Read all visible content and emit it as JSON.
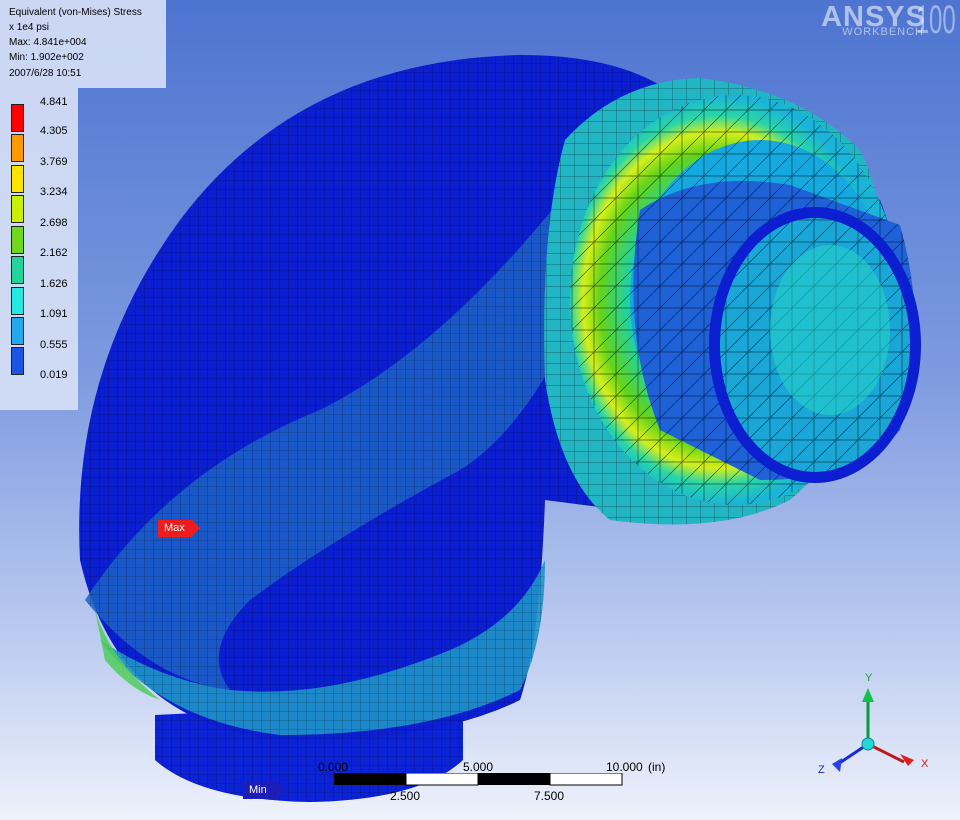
{
  "result": {
    "title": "Equivalent (von-Mises) Stress",
    "units": "x 1e4 psi",
    "max": "Max: 4.841e+004",
    "min": "Min: 1.902e+002",
    "timestamp": "2007/6/28 10:51"
  },
  "legend": {
    "entries": [
      {
        "label": "4.841",
        "color": "#ff0000"
      },
      {
        "label": "4.305",
        "color": "#ff9900"
      },
      {
        "label": "3.769",
        "color": "#ffe300"
      },
      {
        "label": "3.234",
        "color": "#c8f000"
      },
      {
        "label": "2.698",
        "color": "#6fd81c"
      },
      {
        "label": "2.162",
        "color": "#22d39a"
      },
      {
        "label": "1.626",
        "color": "#25e8e0"
      },
      {
        "label": "1.091",
        "color": "#25a7ee"
      },
      {
        "label": "0.555",
        "color": "#1a55e6"
      },
      {
        "label": "0.019",
        "color": "#0d0dc8"
      }
    ]
  },
  "brand": {
    "name": "ANSYS",
    "version": "100",
    "sub": "WORKBENCH"
  },
  "probes": {
    "max_label": "Max",
    "min_label": "Min"
  },
  "scale_bar": {
    "top_labels": [
      "0.000",
      "5.000",
      "10.000"
    ],
    "bottom_labels": [
      "2.500",
      "7.500"
    ],
    "unit": "(in)"
  },
  "triad": {
    "x": "X",
    "y": "Y",
    "z": "Z"
  },
  "colors": {
    "background_top": "#4d74d0",
    "background_bottom": "#eef2fb",
    "mesh_dark_blue": "#0c1fd0",
    "mesh_mid_blue": "#1a55e6"
  }
}
